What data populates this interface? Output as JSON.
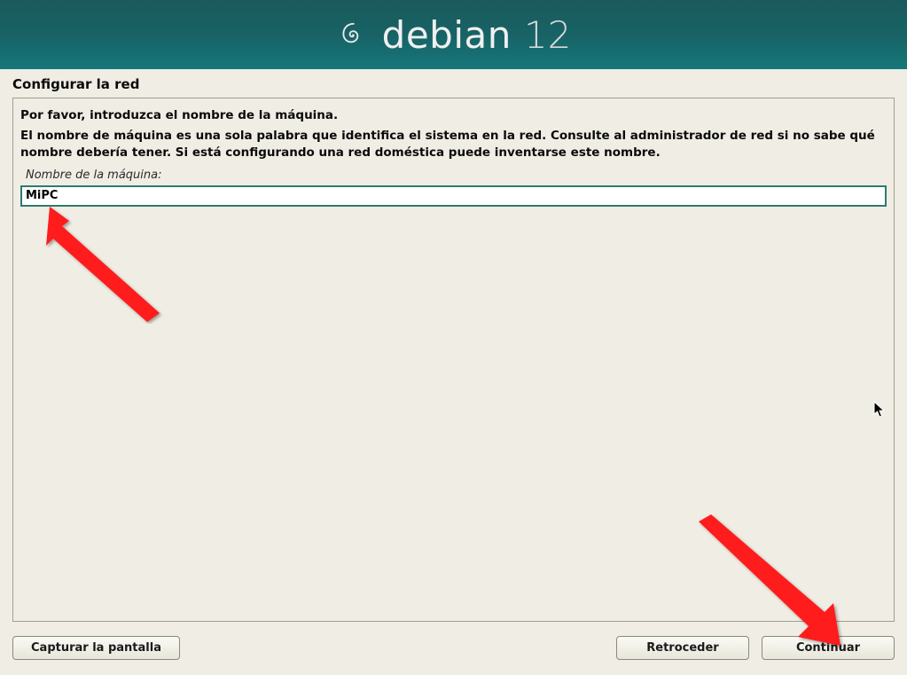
{
  "banner": {
    "brand": "debian",
    "version": "12"
  },
  "page": {
    "title": "Configurar la red"
  },
  "panel": {
    "prompt": "Por favor, introduzca el nombre de la máquina.",
    "description": "El nombre de máquina es una sola palabra que identifica el sistema en la red. Consulte al administrador de red si no sabe qué nombre debería tener. Si está configurando una red doméstica puede inventarse este nombre.",
    "field_label": "Nombre de la máquina:",
    "hostname_value": "MiPC"
  },
  "buttons": {
    "screenshot": "Capturar la pantalla",
    "back": "Retroceder",
    "continue": "Continuar"
  }
}
